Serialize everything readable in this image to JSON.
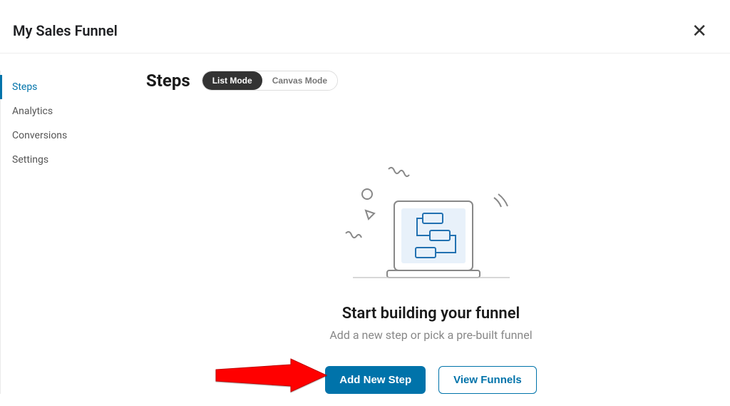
{
  "header": {
    "title": "My Sales Funnel"
  },
  "sidebar": {
    "items": [
      {
        "label": "Steps",
        "active": true
      },
      {
        "label": "Analytics",
        "active": false
      },
      {
        "label": "Conversions",
        "active": false
      },
      {
        "label": "Settings",
        "active": false
      }
    ]
  },
  "main": {
    "section_title": "Steps",
    "mode_toggle": {
      "options": [
        {
          "label": "List Mode",
          "active": true
        },
        {
          "label": "Canvas Mode",
          "active": false
        }
      ]
    },
    "empty_state": {
      "title": "Start building your funnel",
      "subtitle": "Add a new step or pick a pre-built funnel",
      "primary_button": "Add New Step",
      "secondary_button": "View Funnels"
    }
  }
}
